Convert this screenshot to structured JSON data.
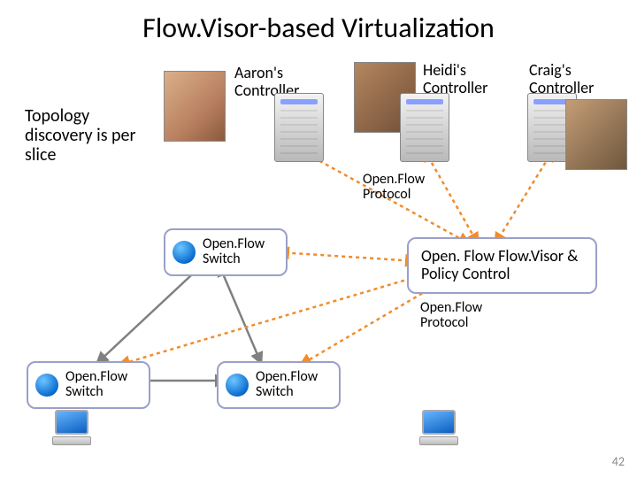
{
  "title": "Flow.Visor-based Virtualization",
  "annotation": "Topology discovery is per slice",
  "controllers": {
    "aaron": "Aaron's Controller",
    "heidi": "Heidi's Controller",
    "craig": "Craig's Controller"
  },
  "protocol_upper": "Open.Flow Protocol",
  "protocol_lower": "Open.Flow Protocol",
  "flowvisor": "Open. Flow Flow.Visor & Policy Control",
  "switch_label": "Open.Flow Switch",
  "page_number": "42"
}
